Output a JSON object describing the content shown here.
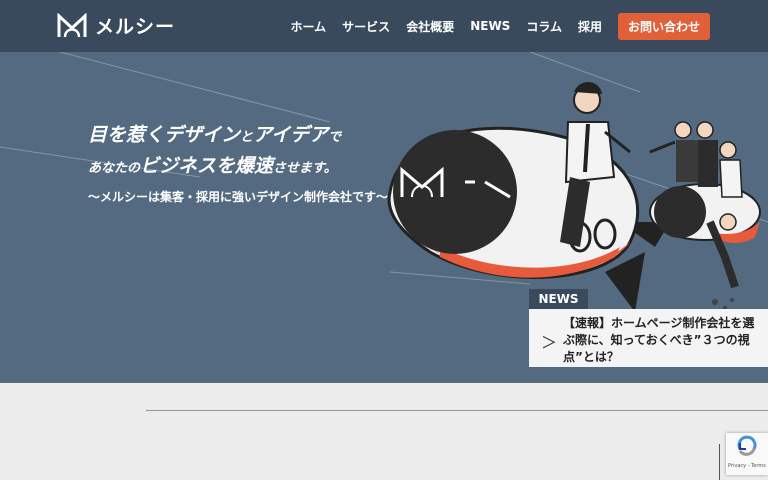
{
  "header": {
    "logo_text": "メルシー",
    "nav": [
      "ホーム",
      "サービス",
      "会社概要",
      "NEWS",
      "コラム",
      "採用"
    ],
    "contact_label": "お問い合わせ"
  },
  "hero": {
    "headline_1a": "目を惹くデザイン",
    "headline_1b": "と",
    "headline_1c": "アイデア",
    "headline_1d": "で",
    "headline_2a": "あなたの",
    "headline_2b": "ビジネスを爆速",
    "headline_2c": "させます。",
    "subline": "〜メルシーは集客・採用に強いデザイン制作会社です〜"
  },
  "news": {
    "tag": "NEWS",
    "arrow": "＞",
    "text": "【速報】ホームページ制作会社を選ぶ際に、知っておくべき”３つの視点”とは？"
  },
  "recaptcha": {
    "label": "Privacy - Terms"
  },
  "colors": {
    "header": "#384a5c",
    "hero": "#546a80",
    "accent": "#e0603a"
  }
}
